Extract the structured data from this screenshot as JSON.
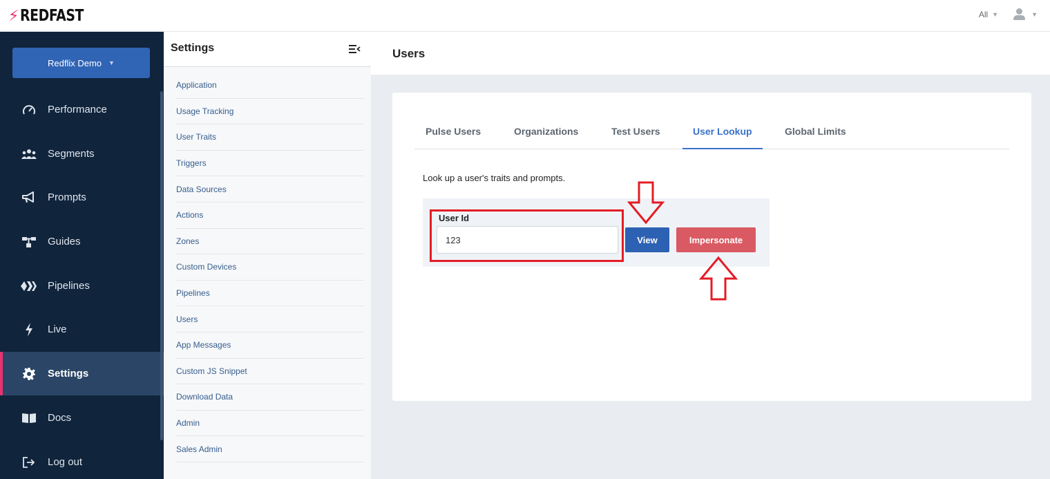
{
  "brand": {
    "logo_text": "REDFAST"
  },
  "topbar": {
    "filter_label": "All"
  },
  "leftnav": {
    "org_selector": "Redflix Demo",
    "items": [
      {
        "label": "Performance",
        "icon": "gauge-icon"
      },
      {
        "label": "Segments",
        "icon": "users-icon"
      },
      {
        "label": "Prompts",
        "icon": "megaphone-icon"
      },
      {
        "label": "Guides",
        "icon": "sitemap-icon"
      },
      {
        "label": "Pipelines",
        "icon": "pipelines-icon"
      },
      {
        "label": "Live",
        "icon": "bolt-icon"
      },
      {
        "label": "Settings",
        "icon": "gear-icon",
        "active": true
      },
      {
        "label": "Docs",
        "icon": "book-icon"
      },
      {
        "label": "Log out",
        "icon": "logout-icon"
      }
    ]
  },
  "settings": {
    "title": "Settings",
    "items": [
      "Application",
      "Usage Tracking",
      "User Traits",
      "Triggers",
      "Data Sources",
      "Actions",
      "Zones",
      "Custom Devices",
      "Pipelines",
      "Users",
      "App Messages",
      "Custom JS Snippet",
      "Download Data",
      "Admin",
      "Sales Admin"
    ]
  },
  "main": {
    "title": "Users",
    "tabs": [
      "Pulse Users",
      "Organizations",
      "Test Users",
      "User Lookup",
      "Global Limits"
    ],
    "active_tab": "User Lookup",
    "description": "Look up a user's traits and prompts.",
    "field_label": "User Id",
    "field_value": "123",
    "view_label": "View",
    "impersonate_label": "Impersonate"
  },
  "colors": {
    "brand_pink": "#e8336f",
    "nav_bg": "#10243c",
    "primary_blue": "#2d61b3",
    "danger_red": "#d95a63",
    "annotation_red": "#e31c25"
  }
}
